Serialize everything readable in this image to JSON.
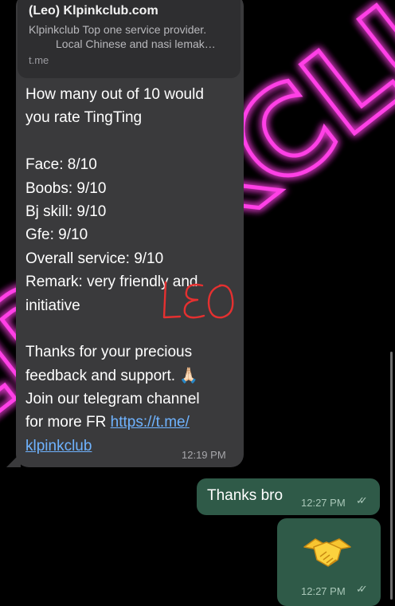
{
  "colors": {
    "neon": "#ff3fe6",
    "incoming_bubble": "#3a3a3c",
    "outgoing_bubble": "#2f5a48",
    "link": "#6fb3ff"
  },
  "background": {
    "neon_sign_text": "KLPINKCLUB",
    "icon": "neon-sign-icon"
  },
  "incoming": {
    "link_preview": {
      "title": "(Leo) Klpinkclub.com",
      "description_line1": "Klpinkclub Top one service provider.",
      "description_line2": "Local Chinese and nasi lemak…",
      "domain": "t.me"
    },
    "lines": {
      "l1": "How many out of 10 would",
      "l2": "you rate TingTing",
      "l3": "Face: 8/10",
      "l4": "Boobs: 9/10",
      "l5": "Bj skill: 9/10",
      "l6": "Gfe: 9/10",
      "l7": "Overall service: 9/10",
      "l8": "Remark: very friendly and",
      "l9": "initiative",
      "l10": "Thanks for your precious",
      "l11": "feedback and support. 🙏🏻",
      "l12": "Join our telegram channel",
      "l13_prefix": "for more FR ",
      "l13_link": "https://t.me/",
      "l14_link": "klpinkclub"
    },
    "time": "12:19 PM",
    "handwritten_mark": "LEO"
  },
  "outgoing": [
    {
      "text": "Thanks bro",
      "time": "12:27 PM",
      "icon": "double-check-icon"
    },
    {
      "emoji": "handshake-icon",
      "time": "12:27 PM",
      "icon": "double-check-icon"
    }
  ]
}
